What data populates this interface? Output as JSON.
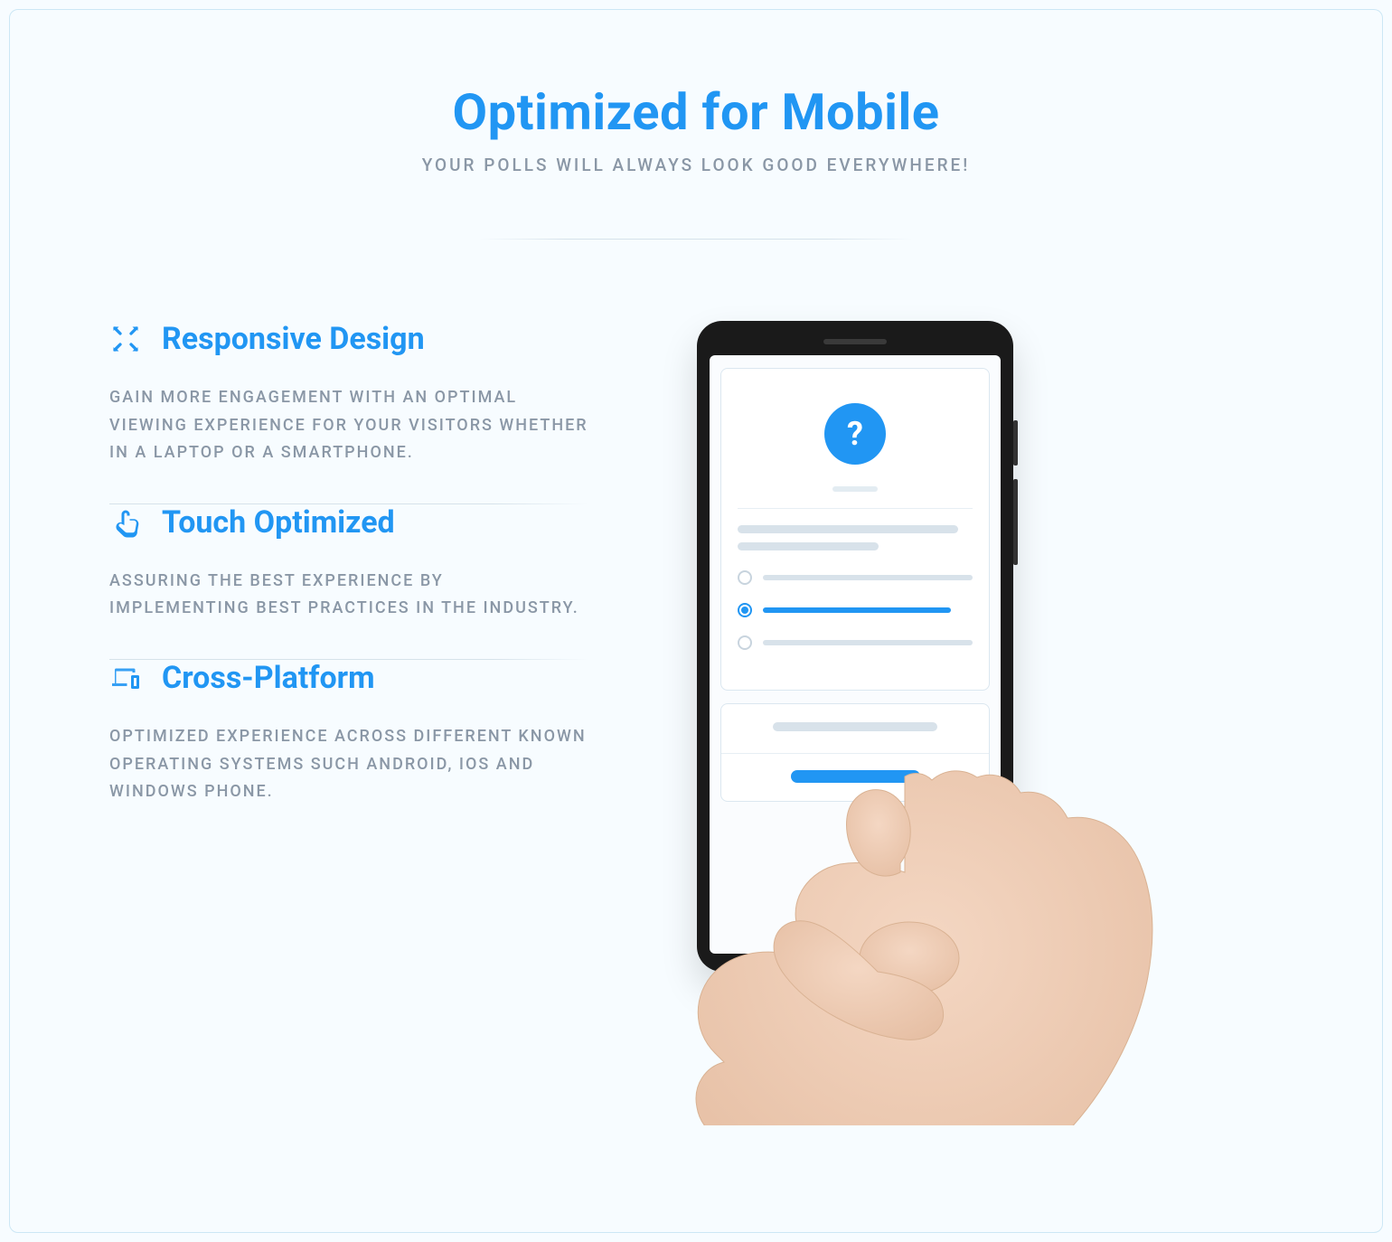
{
  "header": {
    "title": "Optimized for Mobile",
    "subtitle": "YOUR POLLS WILL ALWAYS LOOK GOOD EVERYWHERE!"
  },
  "features": [
    {
      "icon": "expand-icon",
      "title": "Responsive Design",
      "description": "GAIN MORE ENGAGEMENT WITH AN OPTIMAL VIEWING EXPERIENCE FOR YOUR VISITORS WHETHER IN A LAPTOP OR A SMARTPHONE."
    },
    {
      "icon": "touch-icon",
      "title": "Touch Optimized",
      "description": "ASSURING THE BEST EXPERIENCE BY IMPLEMENTING BEST PRACTICES IN THE INDUSTRY."
    },
    {
      "icon": "devices-icon",
      "title": "Cross-Platform",
      "description": "OPTIMIZED EXPERIENCE ACROSS DIFFERENT KNOWN OPERATING SYSTEMS SUCH ANDROID, IOS AND WINDOWS PHONE."
    }
  ],
  "illustration": {
    "question_mark": "?"
  }
}
